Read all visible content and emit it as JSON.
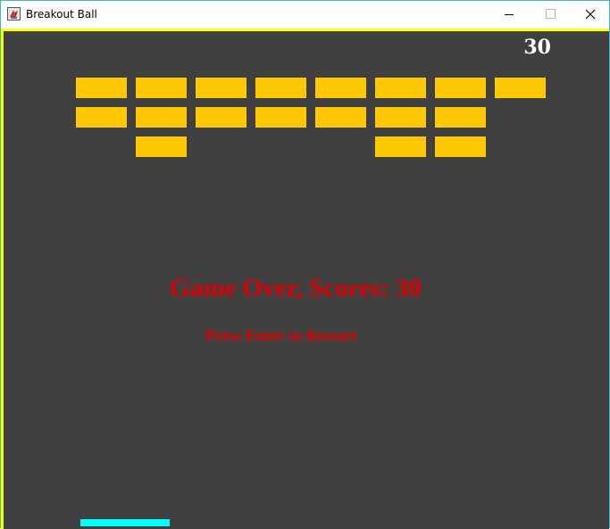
{
  "window": {
    "title": "Breakout Ball",
    "controls": {
      "minimize": "minimize-icon",
      "maximize": "maximize-icon",
      "close": "close-icon"
    }
  },
  "game": {
    "score": "30",
    "game_over_message": "Game Over, Scores: 30",
    "restart_prompt": "Press Enter to Restart",
    "colors": {
      "border": "#ffff00",
      "background": "#404040",
      "brick": "#ffc800",
      "paddle": "#00ffff",
      "score_text": "#ffffff",
      "message_text": "#dc0000"
    },
    "brick_grid": {
      "rows": 3,
      "columns": 8,
      "remaining": [
        [
          1,
          1,
          1,
          1,
          1,
          1,
          1,
          1
        ],
        [
          1,
          1,
          1,
          1,
          1,
          1,
          1,
          0
        ],
        [
          0,
          1,
          0,
          0,
          0,
          1,
          1,
          0
        ]
      ]
    }
  }
}
